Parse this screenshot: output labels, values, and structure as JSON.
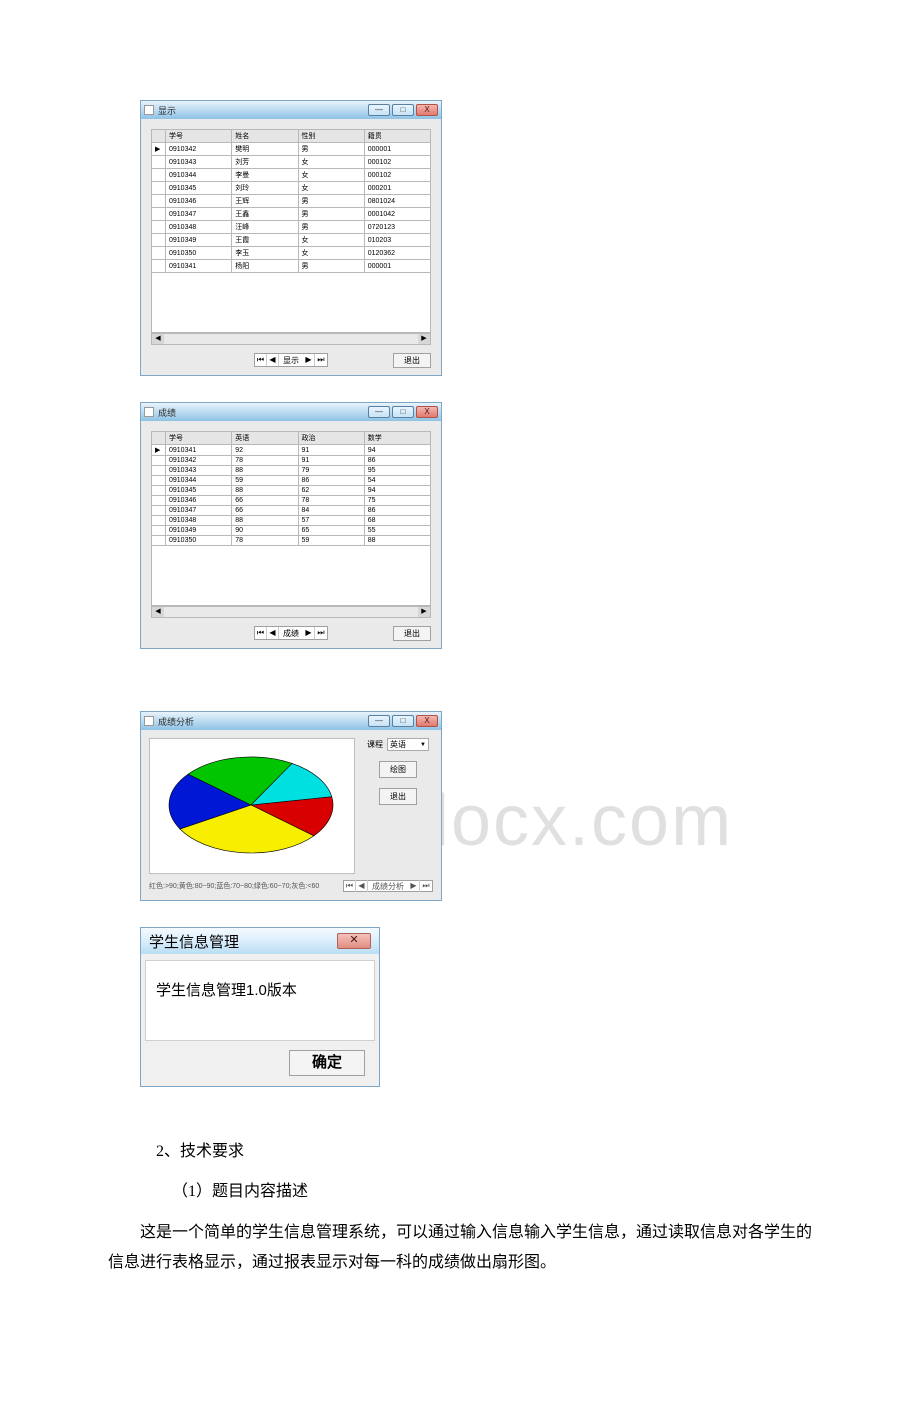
{
  "watermark_text": "www.bdocx.com",
  "window1": {
    "title": "显示",
    "btn_min": "—",
    "btn_max": "□",
    "btn_close": "X",
    "headers": [
      "学号",
      "姓名",
      "性别",
      "籍贯"
    ],
    "rows": [
      [
        "0910342",
        "樊明",
        "男",
        "000001"
      ],
      [
        "0910343",
        "刘芳",
        "女",
        "000102"
      ],
      [
        "0910344",
        "李曼",
        "女",
        "000102"
      ],
      [
        "0910345",
        "刘玲",
        "女",
        "000201"
      ],
      [
        "0910346",
        "王辉",
        "男",
        "0801024"
      ],
      [
        "0910347",
        "王鑫",
        "男",
        "0001042"
      ],
      [
        "0910348",
        "汪峰",
        "男",
        "0720123"
      ],
      [
        "0910349",
        "王霞",
        "女",
        "010203"
      ],
      [
        "0910350",
        "李玉",
        "女",
        "0120362"
      ],
      [
        "0910341",
        "杨阳",
        "男",
        "000001"
      ]
    ],
    "nav_label": "显示",
    "exit_label": "退出",
    "row_marker": "▶"
  },
  "window2": {
    "title": "成绩",
    "btn_min": "—",
    "btn_max": "□",
    "btn_close": "X",
    "headers": [
      "学号",
      "英语",
      "政治",
      "数学"
    ],
    "rows": [
      [
        "0910341",
        "92",
        "91",
        "94"
      ],
      [
        "0910342",
        "78",
        "91",
        "86"
      ],
      [
        "0910343",
        "88",
        "79",
        "95"
      ],
      [
        "0910344",
        "59",
        "86",
        "54"
      ],
      [
        "0910345",
        "88",
        "62",
        "94"
      ],
      [
        "0910346",
        "66",
        "78",
        "75"
      ],
      [
        "0910347",
        "66",
        "84",
        "86"
      ],
      [
        "0910348",
        "88",
        "57",
        "68"
      ],
      [
        "0910349",
        "90",
        "65",
        "55"
      ],
      [
        "0910350",
        "78",
        "59",
        "88"
      ]
    ],
    "nav_label": "成绩",
    "exit_label": "退出",
    "row_marker": "▶"
  },
  "pie_window": {
    "title": "成绩分析",
    "btn_min": "—",
    "btn_max": "□",
    "btn_close": "X",
    "course_label": "课程",
    "course_value": "英语",
    "draw_label": "绘图",
    "exit_label": "退出",
    "legend_text": "红色:>90;黄色:80~90;蓝色:70~80;绿色:60~70;灰色:<60",
    "nav_label": "成绩分析"
  },
  "chart_data": {
    "type": "pie",
    "title": "成绩分析",
    "subject": "英语",
    "slices": [
      {
        "name": ">90",
        "color": "#d80000",
        "count": 2,
        "angle_deg": 50
      },
      {
        "name": "80~90",
        "color": "#f7ee00",
        "count": 3,
        "angle_deg": 110
      },
      {
        "name": "70~80",
        "color": "#0018d6",
        "count": 2,
        "angle_deg": 70
      },
      {
        "name": "60~70",
        "color": "#00c500",
        "count": 2,
        "angle_deg": 80
      },
      {
        "name": "<60",
        "color": "#00e0e0",
        "count": 1,
        "angle_deg": 50
      }
    ],
    "legend": "红色:>90;黄色:80~90;蓝色:70~80;绿色:60~70;灰色:<60"
  },
  "msgbox": {
    "title": "学生信息管理",
    "close_glyph": "✕",
    "body": "学生信息管理1.0版本",
    "ok_label": "确定"
  },
  "article": {
    "p1": "2、技术要求",
    "p2": "（1）题目内容描述",
    "p3": "这是一个简单的学生信息管理系统，可以通过输入信息输入学生信息，通过读取信息对各学生的信息进行表格显示，通过报表显示对每一科的成绩做出扇形图。"
  },
  "nav_glyphs": {
    "first": "⏮",
    "prev": "◀",
    "next": "▶",
    "last": "⏭"
  },
  "scroll": {
    "left": "◀",
    "right": "▶"
  }
}
